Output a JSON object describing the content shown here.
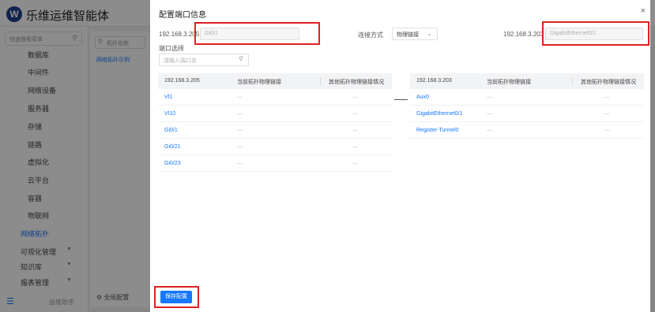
{
  "app": {
    "brand": "乐维运维智能体",
    "logo_letter": "W",
    "sidebar": {
      "search_placeholder": "快速搜索菜单",
      "sub_items": [
        "数据库",
        "中间件",
        "网络设备",
        "服务器",
        "存储",
        "链路",
        "虚拟化",
        "云平台",
        "容器",
        "物联网"
      ],
      "active_item": "网络拓扑",
      "top_items": [
        "可视化管理",
        "知识库",
        "报表管理"
      ],
      "bottom_text": "运维助手"
    },
    "mid_panel": {
      "search_placeholder": "拓扑名称",
      "item": "网络拓扑示例",
      "bottom": "全局配置"
    }
  },
  "dialog": {
    "title": "配置端口信息",
    "close": "×",
    "left_ip": "192.168.3.205",
    "left_port_value": "Gi0/1",
    "connection_label": "连接方式",
    "connection_value": "物理链接",
    "right_ip": "192.168.3.203",
    "right_port_value": "GigabitEthernet0/1",
    "port_select_label": "端口选择",
    "port_search_placeholder": "请输入端口名",
    "save_label": "保存配置"
  },
  "left_table": {
    "headers": [
      "192.168.3.205",
      "当前拓扑物理链接",
      "其他拓扑物理链接情况"
    ],
    "rows": [
      [
        "Vl1",
        "—",
        "—"
      ],
      [
        "Vl10",
        "—",
        "—"
      ],
      [
        "Gi0/1",
        "—",
        "—"
      ],
      [
        "Gi0/21",
        "—",
        "—"
      ],
      [
        "Gi0/23",
        "—",
        "—"
      ]
    ]
  },
  "right_table": {
    "headers": [
      "192.168.3.203",
      "当前拓扑物理链接",
      "其他拓扑物理链接情况"
    ],
    "rows": [
      [
        "Aux0",
        "—",
        "—"
      ],
      [
        "GigabitEthernet0/1",
        "—",
        "—"
      ],
      [
        "Register-Tunnel0",
        "—",
        "—"
      ]
    ]
  },
  "colors": {
    "accent": "#1677ff",
    "highlight": "#e02020"
  },
  "icons": {
    "logo": "logo-icon",
    "search": "search-icon",
    "close": "close-icon",
    "chevron": "chevron-down-icon",
    "menu": "menu-icon",
    "gear": "gear-icon"
  }
}
